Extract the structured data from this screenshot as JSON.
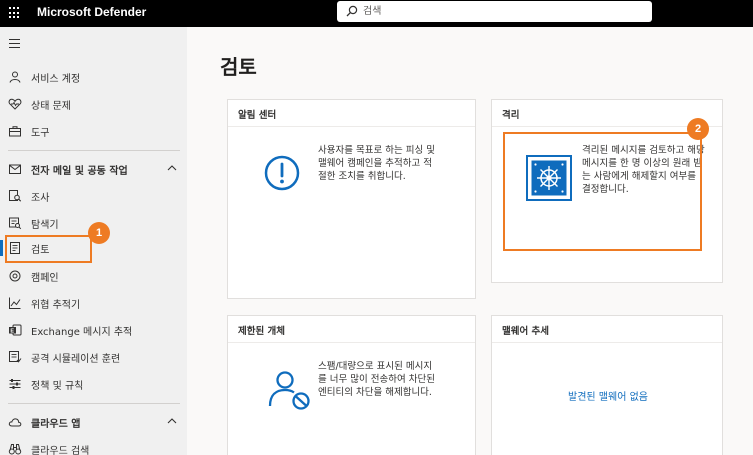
{
  "topbar": {
    "app_title": "Microsoft Defender",
    "search_placeholder": "검색"
  },
  "sidebar": {
    "items": [
      {
        "id": "service-accounts",
        "label": "서비스 계정"
      },
      {
        "id": "health",
        "label": "상태 문제"
      },
      {
        "id": "tools",
        "label": "도구"
      },
      {
        "id": "email-collab",
        "label": "전자 메일 및 공동 작업"
      },
      {
        "id": "investigations",
        "label": "조사"
      },
      {
        "id": "explorer",
        "label": "탐색기"
      },
      {
        "id": "review",
        "label": "검토"
      },
      {
        "id": "campaigns",
        "label": "캠페인"
      },
      {
        "id": "threat-tracker",
        "label": "위협 추적기"
      },
      {
        "id": "exchange-trace",
        "label": "Exchange 메시지 추적"
      },
      {
        "id": "attack-sim",
        "label": "공격 시뮬레이션 훈련"
      },
      {
        "id": "policies",
        "label": "정책 및 규칙"
      },
      {
        "id": "cloud-apps",
        "label": "클라우드 앱"
      },
      {
        "id": "cloud-discovery",
        "label": "클라우드 검색"
      }
    ]
  },
  "annotations": {
    "badge_1": "1",
    "badge_2": "2",
    "highlight_color": "#ee7b23"
  },
  "main": {
    "page_title": "검토",
    "cards": {
      "alert_center": {
        "title": "알림 센터",
        "description": "사용자를 목표로 하는 피싱 및 맬웨어 캠페인을 추적하고 적절한 조치를 취합니다."
      },
      "quarantine": {
        "title": "격리",
        "description": "격리된 메시지를 검토하고 해당 메시지를 한 명 이상의 원래 받는 사람에게 해제할지 여부를 결정합니다."
      },
      "restricted": {
        "title": "제한된 개체",
        "description": "스팸/대량으로 표시된 메시지를 너무 많이 전송하여 차단된 엔티티의 차단을 해제합니다."
      },
      "malware_trends": {
        "title": "맬웨어 추세",
        "link": "발견된 맬웨어 없음"
      }
    }
  },
  "colors": {
    "accent": "#0f6cbd",
    "topbar": "#000000"
  }
}
